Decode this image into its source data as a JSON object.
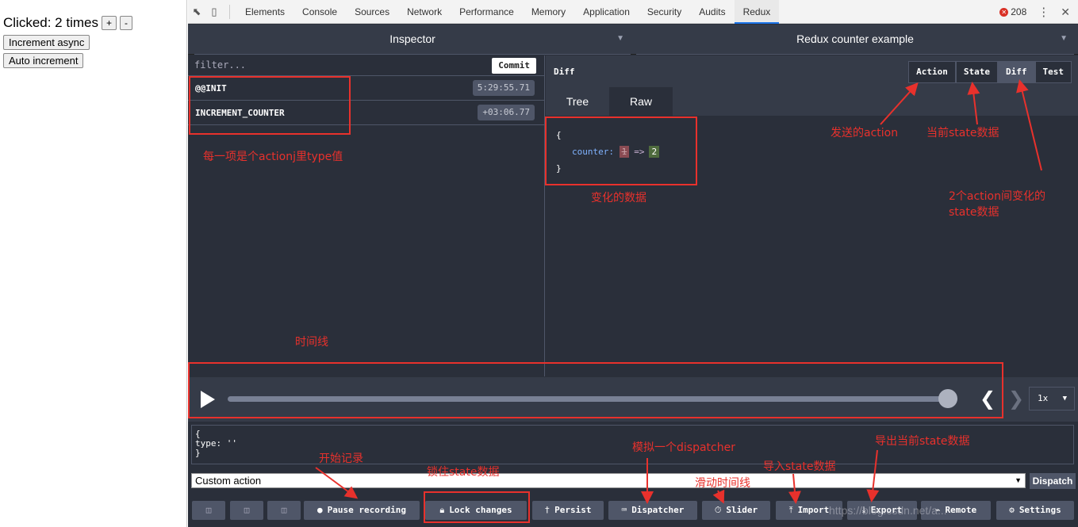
{
  "app": {
    "clicked_text": "Clicked: 2 times",
    "plus_label": "+",
    "minus_label": "-",
    "increment_async_label": "Increment async",
    "auto_increment_label": "Auto increment"
  },
  "devtools": {
    "tabs": [
      "Elements",
      "Console",
      "Sources",
      "Network",
      "Performance",
      "Memory",
      "Application",
      "Security",
      "Audits",
      "Redux"
    ],
    "active_tab": "Redux",
    "error_count": "208"
  },
  "redux": {
    "monitor_select": "Inspector",
    "instance_select": "Redux counter example",
    "filter_placeholder": "filter...",
    "commit_label": "Commit",
    "actions": [
      {
        "name": "@@INIT",
        "time": "5:29:55.71"
      },
      {
        "name": "INCREMENT_COUNTER",
        "time": "+03:06.77"
      }
    ],
    "panel_title": "Diff",
    "view_tabs": [
      "Action",
      "State",
      "Diff",
      "Test"
    ],
    "active_view": "Diff",
    "subtabs": [
      "Tree",
      "Raw"
    ],
    "active_subtab": "Raw",
    "diff": {
      "open": "{",
      "key": "counter:",
      "old": "1",
      "arrow": "=>",
      "new": "2",
      "close": "}"
    },
    "slider_position": 1.0,
    "speed": "1x",
    "dispatcher_text": "{\ntype: ''\n}",
    "custom_action": "Custom action",
    "dispatch_label": "Dispatch",
    "bottom_buttons": {
      "pause": "Pause recording",
      "lock": "Lock changes",
      "persist": "Persist",
      "dispatcher": "Dispatcher",
      "slider": "Slider",
      "import": "Import",
      "export": "Export",
      "remote": "Remote",
      "settings": "Settings"
    }
  },
  "annotations": {
    "action_type": "每一项是个actionj里type值",
    "changed_data": "变化的数据",
    "sent_action": "发送的action",
    "current_state": "当前state数据",
    "diff_state_line1": "2个action间变化的",
    "diff_state_line2": "state数据",
    "timeline": "时间线",
    "start_record": "开始记录",
    "lock_state": "锁住state数据",
    "mock_dispatcher": "模拟一个dispatcher",
    "slide_timeline": "滑动时间线",
    "import_state": "导入state数据",
    "export_state": "导出当前state数据",
    "color": "#e8312c"
  },
  "watermark": "https://blog.csdn.net/a..."
}
